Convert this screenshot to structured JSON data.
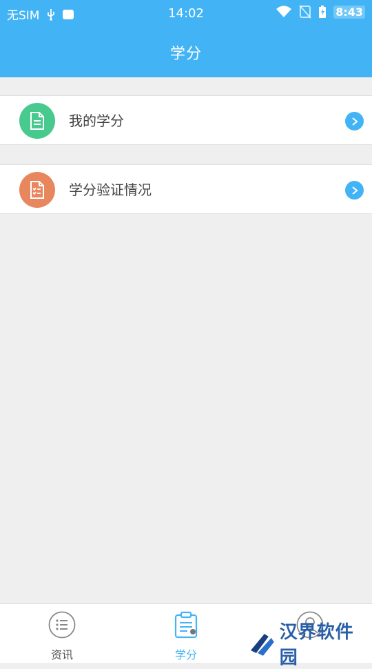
{
  "status_bar": {
    "left_text": "无SIM",
    "time": "14:02",
    "battery_time": "8:43"
  },
  "header": {
    "title": "学分"
  },
  "menu": {
    "items": [
      {
        "label": "我的学分",
        "icon": "document-icon",
        "color": "#48c98d"
      },
      {
        "label": "学分验证情况",
        "icon": "checklist-document-icon",
        "color": "#e8875e"
      }
    ]
  },
  "tabbar": {
    "tabs": [
      {
        "label": "资讯",
        "icon": "list-icon",
        "active": false
      },
      {
        "label": "学分",
        "icon": "clipboard-icon",
        "active": true
      },
      {
        "label": "",
        "icon": "user-icon",
        "active": false
      }
    ]
  },
  "watermark": {
    "text": "汉界软件园"
  },
  "colors": {
    "accent": "#42b4f5",
    "background": "#efefef"
  }
}
